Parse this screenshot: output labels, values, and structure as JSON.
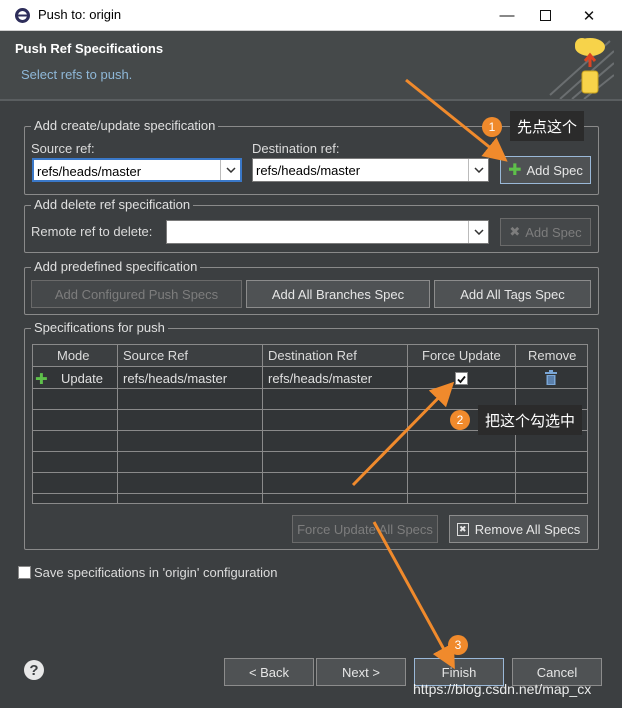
{
  "window": {
    "title": "Push to: origin"
  },
  "header": {
    "title": "Push Ref Specifications",
    "subtitle": "Select refs to push."
  },
  "create_group": {
    "legend": "Add create/update specification",
    "source_label": "Source ref:",
    "source_value": "refs/heads/master",
    "dest_label": "Destination ref:",
    "dest_value": "refs/heads/master",
    "add_spec": "Add Spec"
  },
  "delete_group": {
    "legend": "Add delete ref specification",
    "remote_label": "Remote ref to delete:",
    "remote_value": "",
    "add_spec": "Add Spec"
  },
  "predefined_group": {
    "legend": "Add predefined specification",
    "configured": "Add Configured Push Specs",
    "all_branches": "Add All Branches Spec",
    "all_tags": "Add All Tags Spec"
  },
  "specs_group": {
    "legend": "Specifications for push",
    "columns": [
      "Mode",
      "Source Ref",
      "Destination Ref",
      "Force Update",
      "Remove"
    ],
    "rows": [
      {
        "mode": "Update",
        "source": "refs/heads/master",
        "dest": "refs/heads/master",
        "force": true
      }
    ],
    "force_all": "Force Update All Specs",
    "remove_all": "Remove All Specs"
  },
  "save_label": "Save specifications in 'origin' configuration",
  "buttons": {
    "back": "< Back",
    "next": "Next >",
    "finish": "Finish",
    "cancel": "Cancel"
  },
  "annotations": {
    "callout1": "先点这个",
    "callout2": "把这个勾选中",
    "badge1": "1",
    "badge2": "2",
    "badge3": "3"
  },
  "watermark": "https://blog.csdn.net/map_cx",
  "colors": {
    "accent_arrow": "#f08a2c",
    "header_sub": "#8fb8d8",
    "focus_border": "#3a78c8"
  }
}
